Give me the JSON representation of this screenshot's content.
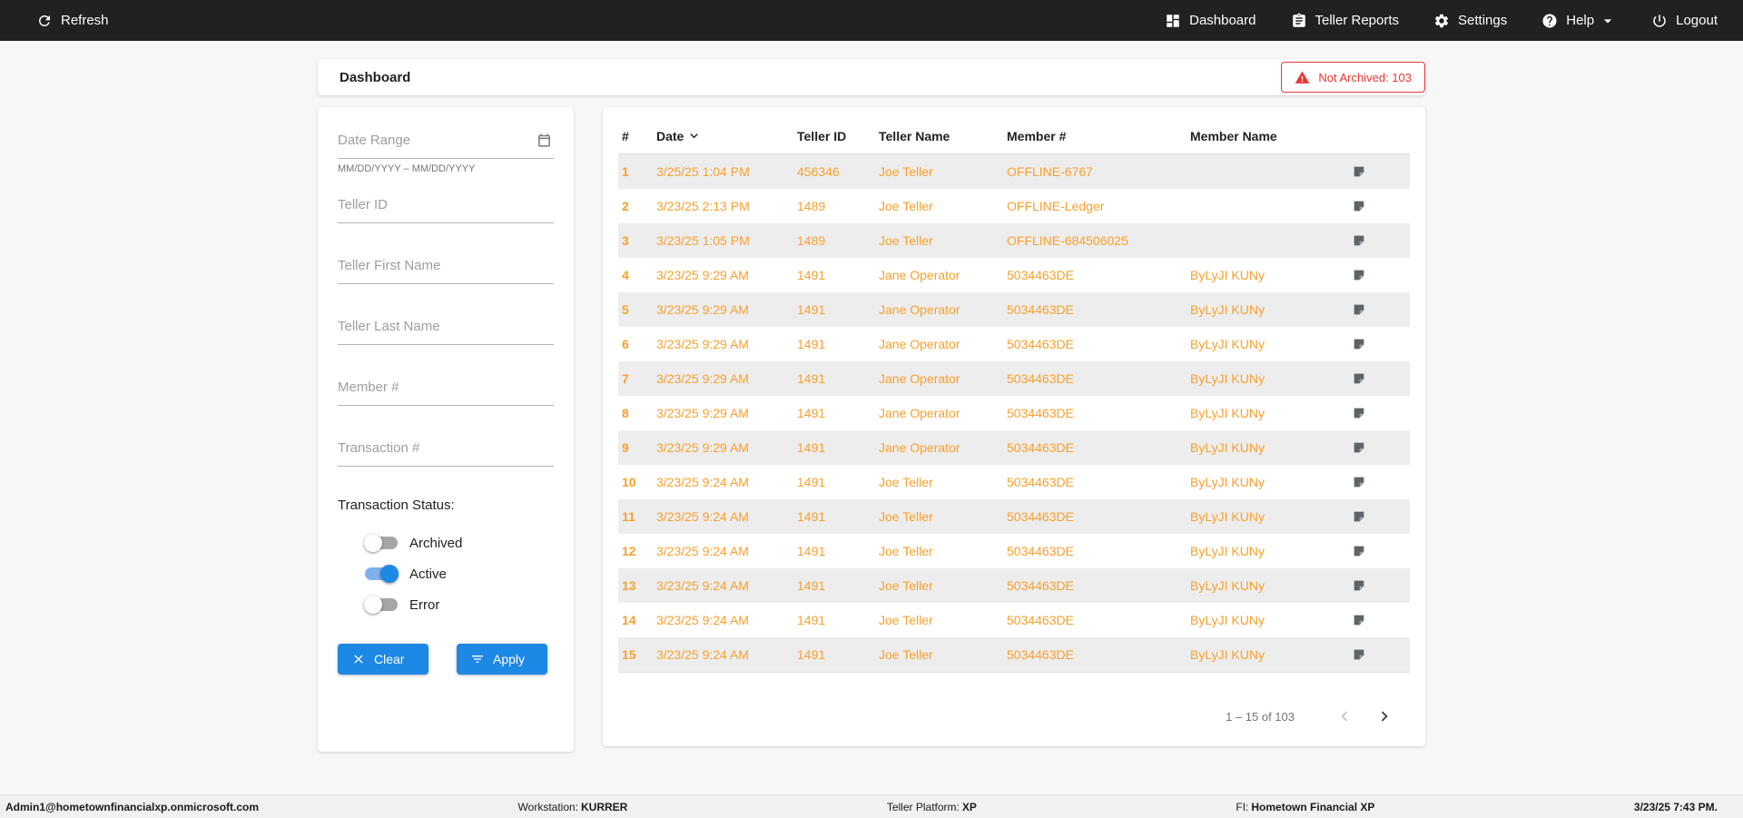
{
  "colors": {
    "navbar_bg": "#212121",
    "page_bg": "#f7f7f7",
    "accent_blue": "#1e88e5",
    "data_orange": "#f8a02c",
    "alert_red": "#e53935",
    "row_shade": "#ededed"
  },
  "navbar": {
    "refresh_label": "Refresh",
    "dashboard_label": "Dashboard",
    "teller_reports_label": "Teller Reports",
    "settings_label": "Settings",
    "help_label": "Help",
    "logout_label": "Logout"
  },
  "page": {
    "title": "Dashboard",
    "not_archived_badge": "Not Archived: 103"
  },
  "filters": {
    "date_range": {
      "placeholder": "Date Range",
      "helper": "MM/DD/YYYY – MM/DD/YYYY"
    },
    "teller_id": {
      "placeholder": "Teller ID"
    },
    "teller_first_name": {
      "placeholder": "Teller First Name"
    },
    "teller_last_name": {
      "placeholder": "Teller Last Name"
    },
    "member_number": {
      "placeholder": "Member #"
    },
    "transaction_number": {
      "placeholder": "Transaction #"
    },
    "status_label": "Transaction Status:",
    "toggles": [
      {
        "label": "Archived",
        "on": false
      },
      {
        "label": "Active",
        "on": true
      },
      {
        "label": "Error",
        "on": false
      }
    ],
    "clear_label": "Clear",
    "apply_label": "Apply"
  },
  "table": {
    "columns": [
      "#",
      "Date",
      "Teller ID",
      "Teller Name",
      "Member #",
      "Member Name"
    ],
    "rows": [
      {
        "num": "1",
        "date": "3/25/25 1:04 PM",
        "teller_id": "456346",
        "teller_name": "Joe Teller",
        "member_number": "OFFLINE-6767",
        "member_name": ""
      },
      {
        "num": "2",
        "date": "3/23/25 2:13 PM",
        "teller_id": "1489",
        "teller_name": "Joe Teller",
        "member_number": "OFFLINE-Ledger",
        "member_name": ""
      },
      {
        "num": "3",
        "date": "3/23/25 1:05 PM",
        "teller_id": "1489",
        "teller_name": "Joe Teller",
        "member_number": "OFFLINE-684506025",
        "member_name": ""
      },
      {
        "num": "4",
        "date": "3/23/25 9:29 AM",
        "teller_id": "1491",
        "teller_name": "Jane Operator",
        "member_number": "5034463DE",
        "member_name": "ByLyJI KUNy"
      },
      {
        "num": "5",
        "date": "3/23/25 9:29 AM",
        "teller_id": "1491",
        "teller_name": "Jane Operator",
        "member_number": "5034463DE",
        "member_name": "ByLyJI KUNy"
      },
      {
        "num": "6",
        "date": "3/23/25 9:29 AM",
        "teller_id": "1491",
        "teller_name": "Jane Operator",
        "member_number": "5034463DE",
        "member_name": "ByLyJI KUNy"
      },
      {
        "num": "7",
        "date": "3/23/25 9:29 AM",
        "teller_id": "1491",
        "teller_name": "Jane Operator",
        "member_number": "5034463DE",
        "member_name": "ByLyJI KUNy"
      },
      {
        "num": "8",
        "date": "3/23/25 9:29 AM",
        "teller_id": "1491",
        "teller_name": "Jane Operator",
        "member_number": "5034463DE",
        "member_name": "ByLyJI KUNy"
      },
      {
        "num": "9",
        "date": "3/23/25 9:29 AM",
        "teller_id": "1491",
        "teller_name": "Jane Operator",
        "member_number": "5034463DE",
        "member_name": "ByLyJI KUNy"
      },
      {
        "num": "10",
        "date": "3/23/25 9:24 AM",
        "teller_id": "1491",
        "teller_name": "Joe Teller",
        "member_number": "5034463DE",
        "member_name": "ByLyJI KUNy"
      },
      {
        "num": "11",
        "date": "3/23/25 9:24 AM",
        "teller_id": "1491",
        "teller_name": "Joe Teller",
        "member_number": "5034463DE",
        "member_name": "ByLyJI KUNy"
      },
      {
        "num": "12",
        "date": "3/23/25 9:24 AM",
        "teller_id": "1491",
        "teller_name": "Joe Teller",
        "member_number": "5034463DE",
        "member_name": "ByLyJI KUNy"
      },
      {
        "num": "13",
        "date": "3/23/25 9:24 AM",
        "teller_id": "1491",
        "teller_name": "Joe Teller",
        "member_number": "5034463DE",
        "member_name": "ByLyJI KUNy"
      },
      {
        "num": "14",
        "date": "3/23/25 9:24 AM",
        "teller_id": "1491",
        "teller_name": "Joe Teller",
        "member_number": "5034463DE",
        "member_name": "ByLyJI KUNy"
      },
      {
        "num": "15",
        "date": "3/23/25 9:24 AM",
        "teller_id": "1491",
        "teller_name": "Joe Teller",
        "member_number": "5034463DE",
        "member_name": "ByLyJI KUNy"
      }
    ],
    "pagination": {
      "range_label": "1 – 15 of 103"
    }
  },
  "footer": {
    "user": "Admin1@hometownfinancialxp.onmicrosoft.com",
    "workstation_label": "Workstation:",
    "workstation_value": "KURRER",
    "platform_label": "Teller Platform:",
    "platform_value": "XP",
    "fi_label": "FI:",
    "fi_value": "Hometown Financial XP",
    "datetime": "3/23/25 7:43 PM."
  }
}
